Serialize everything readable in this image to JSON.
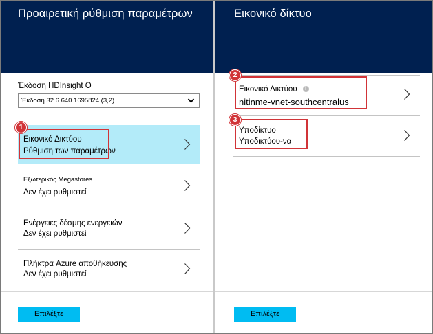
{
  "left_blade": {
    "title": "Προαιρετική ρύθμιση παραμέτρων",
    "version_label": "Έκδοση HDInsight O",
    "version_value": "Έκδοση 32.6.640.1695824 (3,2)",
    "items": [
      {
        "label": "Εικονικό Δικτύου",
        "value": "Ρύθμιση των παραμέτρων"
      },
      {
        "label": "Εξωτερικός  Megastores",
        "value": "Δεν έχει ρυθμιστεί"
      },
      {
        "label": "Ενέργειες δέσμης ενεργειών",
        "value": "Δεν έχει ρυθμιστεί"
      },
      {
        "label": "Πλήκτρα Azure αποθήκευσης",
        "value": "Δεν έχει ρυθμιστεί"
      }
    ],
    "select_label": "Επιλέξτε",
    "callout": "1"
  },
  "right_blade": {
    "title": "Εικονικό δίκτυο",
    "items": [
      {
        "label": "Εικονικό Δικτύου",
        "value": "nitinme-vnet-southcentralus",
        "info_icon": "i"
      },
      {
        "label": "Υποδίκτυο",
        "value": "Υποδικτύου-να"
      }
    ],
    "select_label": "Επιλέξτε",
    "callouts": [
      "2",
      "3"
    ]
  },
  "colors": {
    "header": "#002050",
    "accent_button": "#00bcf2",
    "active_row": "#b3ebf9",
    "callout": "#d13438"
  },
  "icons": [
    "chevron-down-icon",
    "chevron-right-icon",
    "info-icon"
  ]
}
